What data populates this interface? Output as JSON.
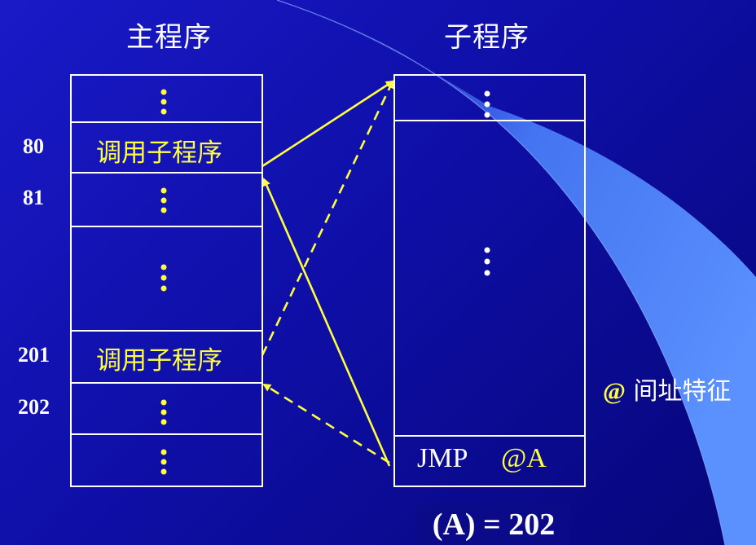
{
  "main_title": "主程序",
  "sub_title": "子程序",
  "addresses": [
    "80",
    "81",
    "201",
    "202"
  ],
  "main_call_1": "调用子程序",
  "main_call_2": "调用子程序",
  "sub_jmp": "JMP",
  "sub_operand": "@A",
  "equation": "(A) = 202",
  "note_symbol": "@",
  "note_text": "间址特征",
  "colors": {
    "background": "#1010b0",
    "box_stroke": "#ffffff",
    "highlight": "#ffff40",
    "wedge": "#4f84ff"
  }
}
